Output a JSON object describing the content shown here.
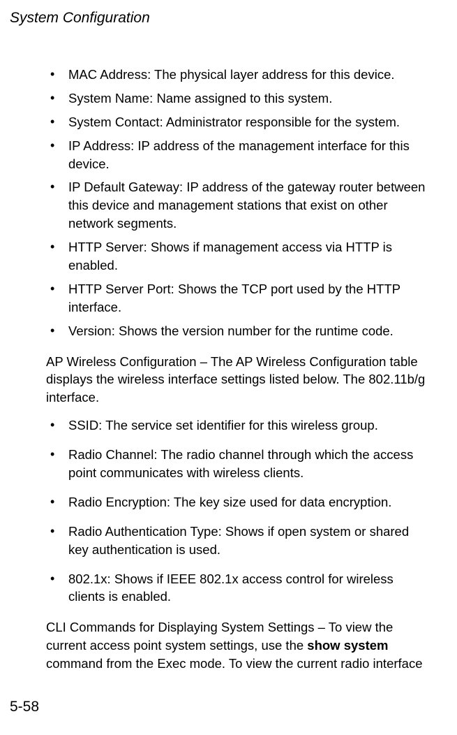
{
  "header": "System Configuration",
  "bullets1": [
    "MAC Address: The physical layer address for this device.",
    "System Name: Name assigned to this system.",
    "System Contact: Administrator responsible for the system.",
    "IP Address: IP address of the management interface for this device.",
    "IP Default Gateway: IP address of the gateway router between this device and management stations that exist on other network segments.",
    "HTTP Server: Shows if management access via HTTP is enabled.",
    "HTTP Server Port: Shows the TCP port used by the HTTP interface.",
    "Version: Shows the version number for the runtime code."
  ],
  "para1": "AP Wireless Configuration – The AP Wireless Configuration table displays the wireless interface settings listed below. The 802.11b/g interface.",
  "bullets2": [
    "SSID: The service set identifier for this wireless group.",
    "Radio Channel: The radio channel through which the access point communicates with wireless clients.",
    "Radio Encryption: The key size used for data encryption.",
    "Radio Authentication Type: Shows if open system or shared key authentication is used.",
    "802.1x: Shows if IEEE 802.1x access control for wireless clients is enabled."
  ],
  "para2_pre": "CLI Commands for Displaying System Settings – To view the current access point system settings, use the ",
  "para2_bold": "show system",
  "para2_post": " command from the Exec mode. To view the current radio interface",
  "pageNumber": "5-58"
}
